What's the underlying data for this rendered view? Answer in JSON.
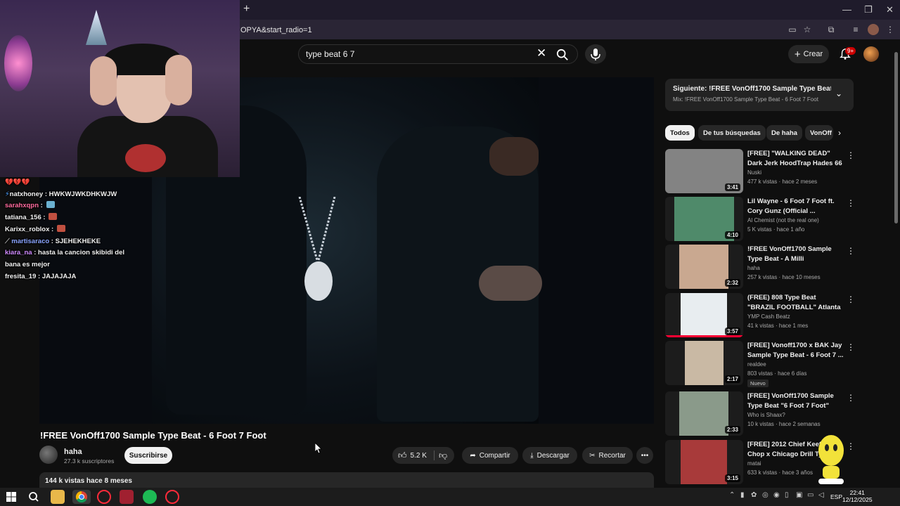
{
  "browser": {
    "new_tab": "+",
    "url": "OPYA&start_radio=1",
    "window_controls": [
      "—",
      "❐",
      "✕"
    ]
  },
  "header": {
    "search_value": "type beat 6 7",
    "create_label": "Crear",
    "notifications_badge": "9+"
  },
  "stream": {
    "chat_top_emotes": "💔💔💔",
    "chat": [
      {
        "user": "natxhoney",
        "color": "#f1f1f1",
        "msg": "HWKWJWKDHKWJW",
        "emote": false
      },
      {
        "user": "sarahxqpn",
        "color": "#ff6b9d",
        "msg": "",
        "emote": true
      },
      {
        "user": "tatiana_156",
        "color": "#f1f1f1",
        "msg": "",
        "emote": true
      },
      {
        "user": "Karixx_roblox",
        "color": "#f1f1f1",
        "msg": "",
        "emote": true
      },
      {
        "user": "martisaraco",
        "color": "#8aa4ff",
        "msg": "SJEHEKHEKE",
        "emote": false
      },
      {
        "user": "kiara_na",
        "color": "#d08aff",
        "msg": "hasta la cancion skibidi del bana es mejor",
        "emote": false
      },
      {
        "user": "fresita_19",
        "color": "#f1f1f1",
        "msg": "JAJAJAJA",
        "emote": false
      }
    ]
  },
  "video": {
    "title": "!FREE VonOff1700 Sample Type Beat - 6 Foot 7 Foot",
    "channel": "haha",
    "subscribers": "27.3 k suscriptores",
    "subscribe_label": "Suscribirse",
    "likes": "5.2 K",
    "share_label": "Compartir",
    "download_label": "Descargar",
    "clip_label": "Recortar",
    "views_date": "144 k vistas  hace 8 meses"
  },
  "sidebar": {
    "next_title": "Siguiente: !FREE VonOff1700 Sample Type Beat - D...",
    "next_sub": "Mix: !FREE VonOff1700 Sample Type Beat - 6 Foot 7 Foot",
    "chips": [
      "Todos",
      "De tus búsquedas",
      "De haha",
      "VonOff"
    ],
    "items": [
      {
        "title": "[FREE] \"WALKING DEAD\" Dark Jerk HoodTrap Hades 66 x Laj...",
        "channel": "Nuski",
        "meta": "477 k vistas · hace 2 meses",
        "duration": "3:41",
        "badge": "",
        "thumb": "#d8d8d8"
      },
      {
        "title": "Lil Wayne - 6 Foot 7 Foot ft. Cory Gunz (Official ...",
        "channel": "Al Chemist (not the real one)",
        "meta": "5 K vistas · hace 1 año",
        "duration": "4:10",
        "badge": "",
        "thumb": "#4f8a6a"
      },
      {
        "title": "!FREE VonOff1700 Sample Type Beat - A Milli",
        "channel": "haha",
        "meta": "257 k vistas · hace 10 meses",
        "duration": "2:32",
        "badge": "",
        "thumb": "#c9a890"
      },
      {
        "title": "(FREE) 808 Type Beat \"BRAZIL FOOTBALL\" Atlanta Type Beat",
        "channel": "YMP Cash Beatz",
        "meta": "41 k vistas · hace 1 mes",
        "duration": "3:57",
        "badge": "",
        "thumb": "#e8edf0"
      },
      {
        "title": "[FREE] Vonoff1700 x BAK Jay Sample Type Beat - 6 Foot 7 ...",
        "channel": "realdee",
        "meta": "803 vistas · hace 6 días",
        "duration": "2:17",
        "badge": "Nuevo",
        "thumb": "#c9b9a4"
      },
      {
        "title": "[FREE] VonOff1700 Sample Type Beat \"6 Foot 7 Foot\"",
        "channel": "Who is Shaax?",
        "meta": "10 k vistas · hace 2 semanas",
        "duration": "2:33",
        "badge": "",
        "thumb": "#8a9a8a"
      },
      {
        "title": "[FREE] 2012 Chief Keef x Chop x Chicago Drill Type...",
        "channel": "matai",
        "meta": "633 k vistas · hace 3 años",
        "duration": "3:15",
        "badge": "",
        "thumb": "#a83a3a"
      }
    ]
  },
  "taskbar": {
    "lang": "ESP",
    "time": "22:41",
    "date": "12/12/2025"
  }
}
